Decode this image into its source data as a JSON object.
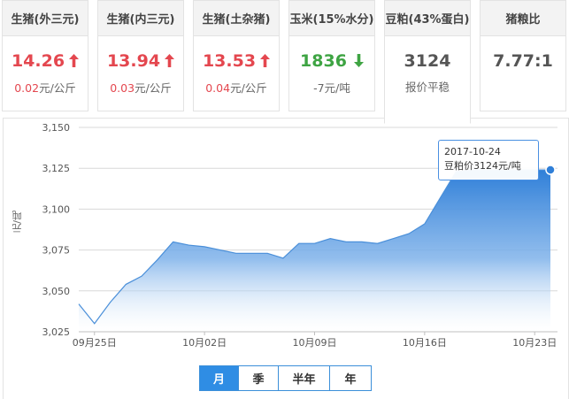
{
  "cards": [
    {
      "name": "生猪(外三元)",
      "price": "14.26",
      "trend": "up",
      "change_value": "0.02",
      "change_unit": "元/公斤"
    },
    {
      "name": "生猪(内三元)",
      "price": "13.94",
      "trend": "up",
      "change_value": "0.03",
      "change_unit": "元/公斤"
    },
    {
      "name": "生猪(土杂猪)",
      "price": "13.53",
      "trend": "up",
      "change_value": "0.04",
      "change_unit": "元/公斤"
    },
    {
      "name": "玉米(15%水分)",
      "price": "1836",
      "trend": "down",
      "change_value": "-7",
      "change_unit": "元/吨"
    },
    {
      "name": "豆粕(43%蛋白)",
      "price": "3124",
      "trend": "flat",
      "change_value": "报价平稳",
      "change_unit": ""
    },
    {
      "name": "猪粮比",
      "price": "7.77:1",
      "trend": "flat",
      "change_value": "",
      "change_unit": ""
    }
  ],
  "colors": {
    "up": "#e4474f",
    "down": "#3ea443",
    "accent": "#2f8de4"
  },
  "icons": {
    "up": "arrow-up-icon",
    "down": "arrow-down-icon"
  },
  "range_tabs": [
    {
      "label": "月",
      "selected": true
    },
    {
      "label": "季",
      "selected": false
    },
    {
      "label": "半年",
      "selected": false
    },
    {
      "label": "年",
      "selected": false
    }
  ],
  "tooltip": {
    "date": "2017-10-24",
    "text": "豆粕价3124元/吨"
  },
  "chart_data": {
    "type": "area",
    "title": "",
    "xlabel": "",
    "ylabel": "元/吨",
    "ylim": [
      3025,
      3150
    ],
    "yticks": [
      3025,
      3050,
      3075,
      3100,
      3125,
      3150
    ],
    "ytick_labels": [
      "3,025",
      "3,050",
      "3,075",
      "3,100",
      "3,125",
      "3,150"
    ],
    "xtick_labels": [
      "09月25日",
      "10月02日",
      "10月09日",
      "10月16日",
      "10月23日"
    ],
    "grid": true,
    "series": [
      {
        "x": [
          "09-24",
          "09-25",
          "09-26",
          "09-27",
          "09-28",
          "09-29",
          "09-30",
          "10-01",
          "10-02",
          "10-03",
          "10-04",
          "10-05",
          "10-06",
          "10-07",
          "10-08",
          "10-09",
          "10-10",
          "10-11",
          "10-12",
          "10-13",
          "10-14",
          "10-15",
          "10-16",
          "10-17",
          "10-18",
          "10-19",
          "10-20",
          "10-21",
          "10-22",
          "10-23",
          "10-24"
        ],
        "values": [
          3042,
          3030,
          3043,
          3054,
          3059,
          3069,
          3080,
          3078,
          3077,
          3075,
          3073,
          3073,
          3073,
          3070,
          3079,
          3079,
          3082,
          3080,
          3080,
          3079,
          3082,
          3085,
          3091,
          3107,
          3123,
          3124,
          3124,
          3124,
          3124,
          3124,
          3124
        ]
      }
    ]
  }
}
